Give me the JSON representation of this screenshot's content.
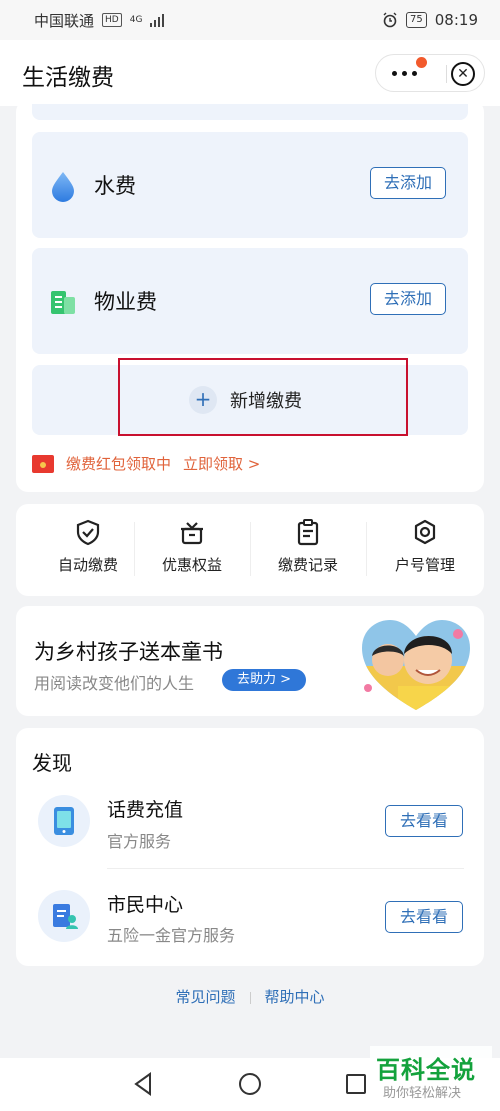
{
  "status_bar": {
    "carrier": "中国联通",
    "hd": "HD",
    "network": "4G",
    "battery": "75",
    "time": "08:19"
  },
  "header": {
    "title": "生活缴费"
  },
  "bills": [
    {
      "name": "水费",
      "button": "去添加",
      "icon": "water-drop-icon"
    },
    {
      "name": "物业费",
      "button": "去添加",
      "icon": "property-building-icon"
    }
  ],
  "new_fee": {
    "label": "新增缴费",
    "icon": "plus-icon"
  },
  "promo": {
    "text": "缴费红包领取中",
    "link": "立即领取 >"
  },
  "quick_actions": [
    {
      "label": "自动缴费",
      "icon": "shield-check-icon"
    },
    {
      "label": "优惠权益",
      "icon": "gift-icon"
    },
    {
      "label": "缴费记录",
      "icon": "clipboard-icon"
    },
    {
      "label": "户号管理",
      "icon": "gear-icon"
    }
  ],
  "banner": {
    "title": "为乡村孩子送本童书",
    "subtitle": "用阅读改变他们的人生",
    "button": "去助力 >"
  },
  "discover": {
    "title": "发现",
    "items": [
      {
        "name": "话费充值",
        "desc": "官方服务",
        "button": "去看看",
        "icon": "phone-icon"
      },
      {
        "name": "市民中心",
        "desc": "五险一金官方服务",
        "button": "去看看",
        "icon": "citizen-doc-icon"
      }
    ]
  },
  "footer_links": [
    "常见问题",
    "帮助中心"
  ],
  "watermark": {
    "line1": "百科全说",
    "line2": "助你轻松解决"
  },
  "colors": {
    "accent": "#2f6fb7",
    "promo": "#e0633b",
    "highlight_box": "#c8102e",
    "row_bg": "#eef3fb"
  }
}
